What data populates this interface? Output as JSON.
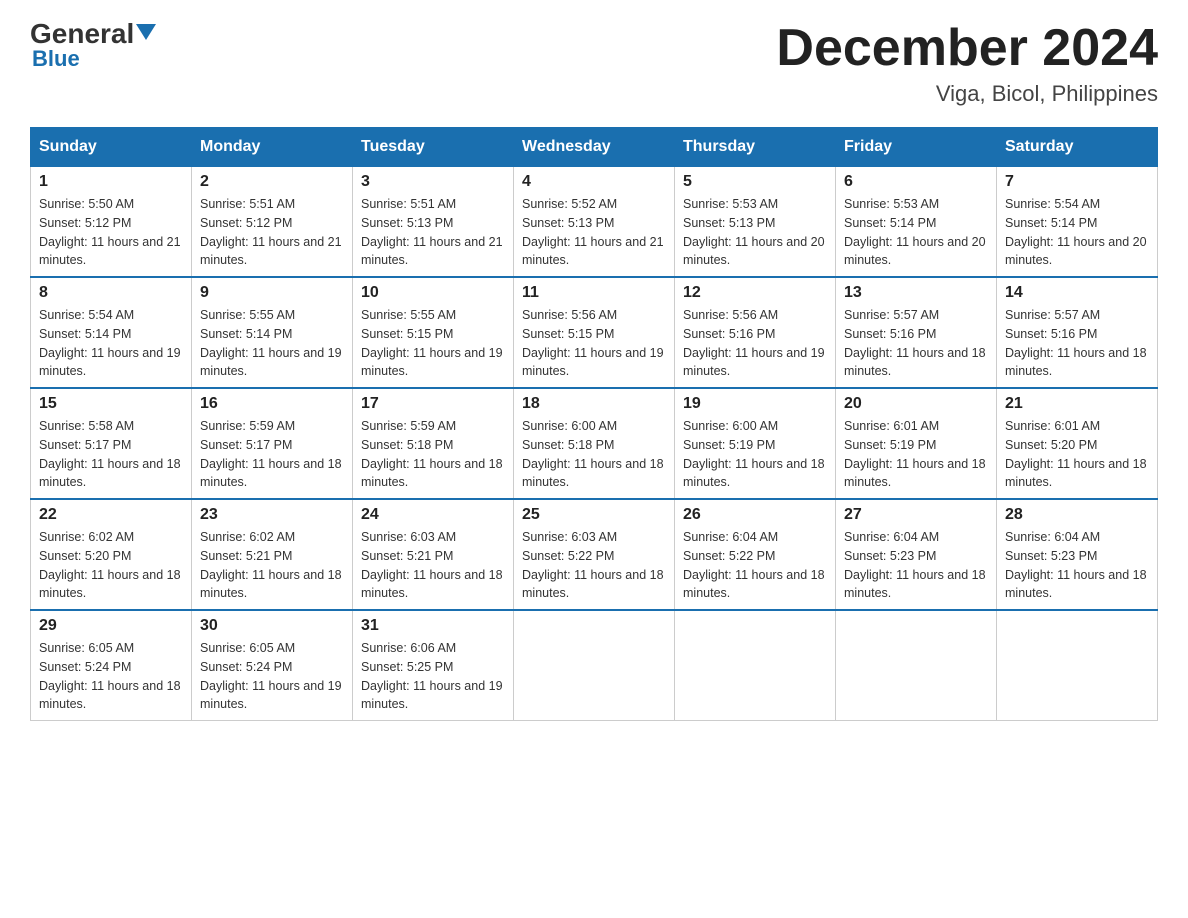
{
  "logo": {
    "general": "General",
    "blue": "Blue",
    "triangle": "▼"
  },
  "title": "December 2024",
  "subtitle": "Viga, Bicol, Philippines",
  "days_of_week": [
    "Sunday",
    "Monday",
    "Tuesday",
    "Wednesday",
    "Thursday",
    "Friday",
    "Saturday"
  ],
  "weeks": [
    [
      {
        "date": "1",
        "sunrise": "5:50 AM",
        "sunset": "5:12 PM",
        "daylight": "11 hours and 21 minutes."
      },
      {
        "date": "2",
        "sunrise": "5:51 AM",
        "sunset": "5:12 PM",
        "daylight": "11 hours and 21 minutes."
      },
      {
        "date": "3",
        "sunrise": "5:51 AM",
        "sunset": "5:13 PM",
        "daylight": "11 hours and 21 minutes."
      },
      {
        "date": "4",
        "sunrise": "5:52 AM",
        "sunset": "5:13 PM",
        "daylight": "11 hours and 21 minutes."
      },
      {
        "date": "5",
        "sunrise": "5:53 AM",
        "sunset": "5:13 PM",
        "daylight": "11 hours and 20 minutes."
      },
      {
        "date": "6",
        "sunrise": "5:53 AM",
        "sunset": "5:14 PM",
        "daylight": "11 hours and 20 minutes."
      },
      {
        "date": "7",
        "sunrise": "5:54 AM",
        "sunset": "5:14 PM",
        "daylight": "11 hours and 20 minutes."
      }
    ],
    [
      {
        "date": "8",
        "sunrise": "5:54 AM",
        "sunset": "5:14 PM",
        "daylight": "11 hours and 19 minutes."
      },
      {
        "date": "9",
        "sunrise": "5:55 AM",
        "sunset": "5:14 PM",
        "daylight": "11 hours and 19 minutes."
      },
      {
        "date": "10",
        "sunrise": "5:55 AM",
        "sunset": "5:15 PM",
        "daylight": "11 hours and 19 minutes."
      },
      {
        "date": "11",
        "sunrise": "5:56 AM",
        "sunset": "5:15 PM",
        "daylight": "11 hours and 19 minutes."
      },
      {
        "date": "12",
        "sunrise": "5:56 AM",
        "sunset": "5:16 PM",
        "daylight": "11 hours and 19 minutes."
      },
      {
        "date": "13",
        "sunrise": "5:57 AM",
        "sunset": "5:16 PM",
        "daylight": "11 hours and 18 minutes."
      },
      {
        "date": "14",
        "sunrise": "5:57 AM",
        "sunset": "5:16 PM",
        "daylight": "11 hours and 18 minutes."
      }
    ],
    [
      {
        "date": "15",
        "sunrise": "5:58 AM",
        "sunset": "5:17 PM",
        "daylight": "11 hours and 18 minutes."
      },
      {
        "date": "16",
        "sunrise": "5:59 AM",
        "sunset": "5:17 PM",
        "daylight": "11 hours and 18 minutes."
      },
      {
        "date": "17",
        "sunrise": "5:59 AM",
        "sunset": "5:18 PM",
        "daylight": "11 hours and 18 minutes."
      },
      {
        "date": "18",
        "sunrise": "6:00 AM",
        "sunset": "5:18 PM",
        "daylight": "11 hours and 18 minutes."
      },
      {
        "date": "19",
        "sunrise": "6:00 AM",
        "sunset": "5:19 PM",
        "daylight": "11 hours and 18 minutes."
      },
      {
        "date": "20",
        "sunrise": "6:01 AM",
        "sunset": "5:19 PM",
        "daylight": "11 hours and 18 minutes."
      },
      {
        "date": "21",
        "sunrise": "6:01 AM",
        "sunset": "5:20 PM",
        "daylight": "11 hours and 18 minutes."
      }
    ],
    [
      {
        "date": "22",
        "sunrise": "6:02 AM",
        "sunset": "5:20 PM",
        "daylight": "11 hours and 18 minutes."
      },
      {
        "date": "23",
        "sunrise": "6:02 AM",
        "sunset": "5:21 PM",
        "daylight": "11 hours and 18 minutes."
      },
      {
        "date": "24",
        "sunrise": "6:03 AM",
        "sunset": "5:21 PM",
        "daylight": "11 hours and 18 minutes."
      },
      {
        "date": "25",
        "sunrise": "6:03 AM",
        "sunset": "5:22 PM",
        "daylight": "11 hours and 18 minutes."
      },
      {
        "date": "26",
        "sunrise": "6:04 AM",
        "sunset": "5:22 PM",
        "daylight": "11 hours and 18 minutes."
      },
      {
        "date": "27",
        "sunrise": "6:04 AM",
        "sunset": "5:23 PM",
        "daylight": "11 hours and 18 minutes."
      },
      {
        "date": "28",
        "sunrise": "6:04 AM",
        "sunset": "5:23 PM",
        "daylight": "11 hours and 18 minutes."
      }
    ],
    [
      {
        "date": "29",
        "sunrise": "6:05 AM",
        "sunset": "5:24 PM",
        "daylight": "11 hours and 18 minutes."
      },
      {
        "date": "30",
        "sunrise": "6:05 AM",
        "sunset": "5:24 PM",
        "daylight": "11 hours and 19 minutes."
      },
      {
        "date": "31",
        "sunrise": "6:06 AM",
        "sunset": "5:25 PM",
        "daylight": "11 hours and 19 minutes."
      },
      null,
      null,
      null,
      null
    ]
  ]
}
